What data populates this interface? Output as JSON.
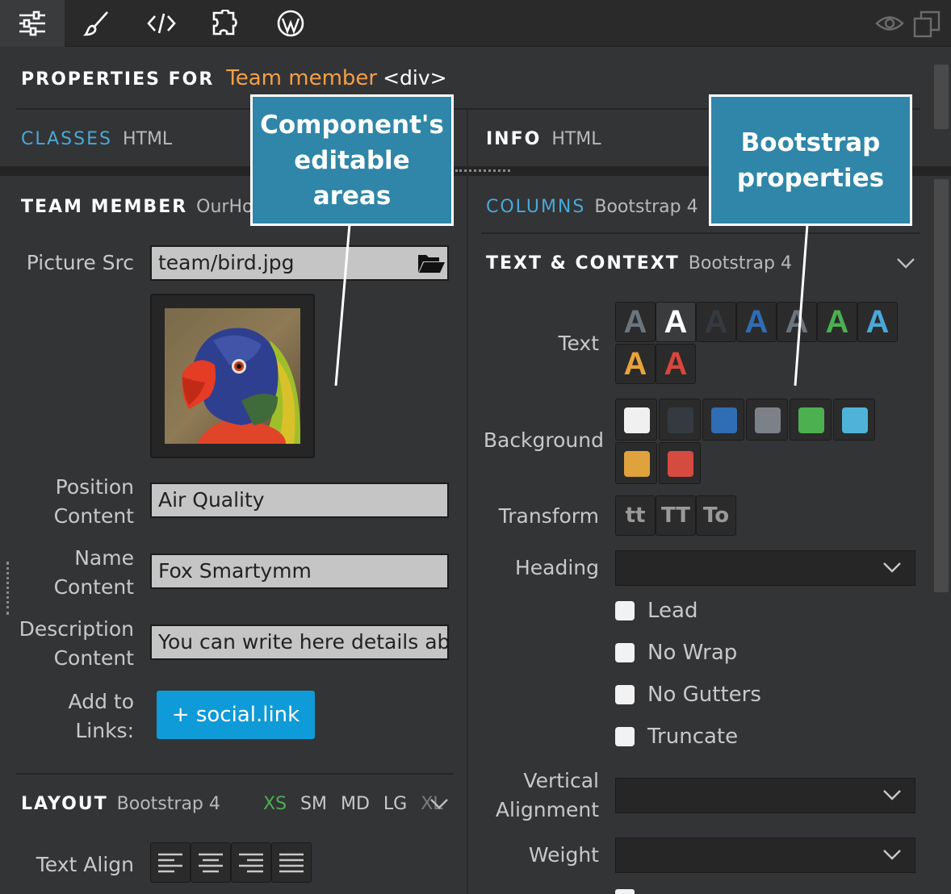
{
  "toolbar": {
    "icons": [
      "sliders-icon",
      "brush-icon",
      "code-icon",
      "puzzle-icon",
      "wordpress-icon",
      "eye-icon",
      "duplicate-icon"
    ]
  },
  "header": {
    "prefix": "PROPERTIES FOR",
    "component": "Team member",
    "tag": "<div>"
  },
  "left_tabs": {
    "classes": "CLASSES",
    "html": "HTML"
  },
  "right_tabs": {
    "info": "INFO",
    "html": "HTML"
  },
  "team_member": {
    "title": "TEAM MEMBER",
    "sub": "OurHome",
    "picture_label": "Picture Src",
    "picture_value": "team/bird.jpg",
    "position_label_1": "Position",
    "position_label_2": "Content",
    "position_value": "Air Quality",
    "name_label_1": "Name",
    "name_label_2": "Content",
    "name_value": "Fox Smartymm",
    "desc_label_1": "Description",
    "desc_label_2": "Content",
    "desc_value": "You can write here details abo",
    "add_label_1": "Add to",
    "add_label_2": "Links:",
    "add_button": "+ social.link"
  },
  "layout": {
    "title": "LAYOUT",
    "sub": "Bootstrap 4",
    "breakpoints": [
      "XS",
      "SM",
      "MD",
      "LG",
      "XL"
    ],
    "active_breakpoint": "XS",
    "text_align_label": "Text Align"
  },
  "columns": {
    "title": "COLUMNS",
    "sub": "Bootstrap 4"
  },
  "text_context": {
    "title": "TEXT & CONTEXT",
    "sub": "Bootstrap 4",
    "text_label": "Text",
    "text_glyph": "A",
    "text_colors": [
      "#6c757d",
      "#ffffff",
      "#343a40",
      "#2f6db5",
      "#6c757d",
      "#4caf50",
      "#48a9d8",
      "#e8a33b",
      "#d9463b"
    ],
    "background_label": "Background",
    "bg_colors": [
      "#f0f0f0",
      "#343a40",
      "#2f6db5",
      "#7c8188",
      "#4caf50",
      "#4fb3d9",
      "#e0a23c",
      "#d64b40"
    ],
    "transform_label": "Transform",
    "transform_options": [
      "tt",
      "TT",
      "To"
    ],
    "heading_label": "Heading",
    "checkboxes": [
      "Lead",
      "No Wrap",
      "No Gutters",
      "Truncate"
    ],
    "valign_label_1": "Vertical",
    "valign_label_2": "Alignment",
    "weight_label": "Weight"
  },
  "callouts": {
    "left": "Component's editable areas",
    "right": "Bootstrap properties"
  }
}
